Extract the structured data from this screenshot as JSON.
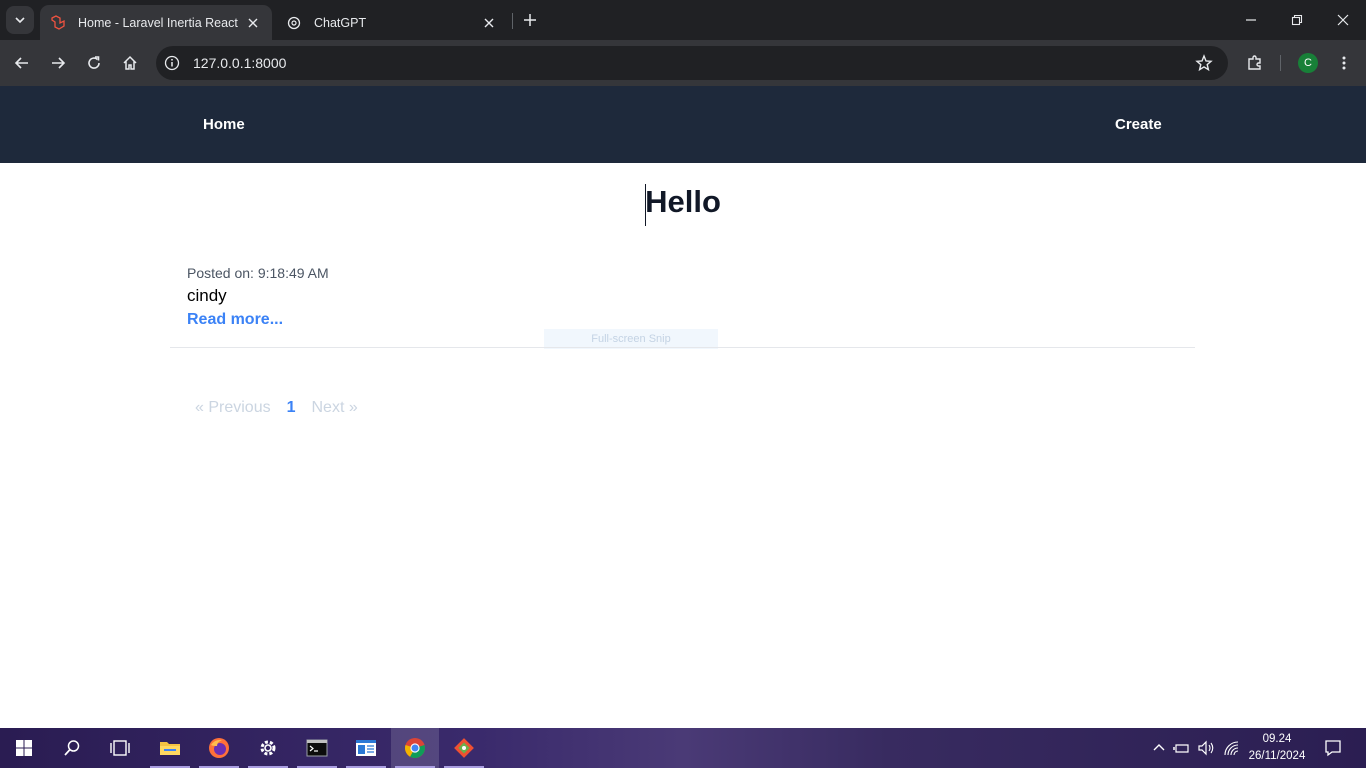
{
  "browser": {
    "tabs": [
      {
        "title": "Home - Laravel Inertia React",
        "icon": "laravel-icon",
        "active": true
      },
      {
        "title": "ChatGPT",
        "icon": "chatgpt-icon",
        "active": false
      }
    ],
    "url": "127.0.0.1:8000",
    "profile_initial": "C"
  },
  "nav": {
    "home_label": "Home",
    "create_label": "Create"
  },
  "page": {
    "title": "Hello",
    "posts": [
      {
        "meta": "Posted on: 9:18:49 AM",
        "author": "cindy",
        "read_more": "Read more..."
      }
    ],
    "overlay_text": "Full-screen Snip"
  },
  "pagination": {
    "previous": "« Previous",
    "current": "1",
    "next": "Next »"
  },
  "taskbar": {
    "apps": [
      "start-icon",
      "search-icon",
      "task-view-icon",
      "file-explorer-icon",
      "firefox-icon",
      "settings-icon",
      "terminal-icon",
      "notepad-icon",
      "chrome-icon",
      "git-icon"
    ],
    "time": "09.24",
    "date": "26/11/2024"
  },
  "colors": {
    "navbar": "#1e293b",
    "link": "#3b82f6",
    "title": "#111827"
  }
}
